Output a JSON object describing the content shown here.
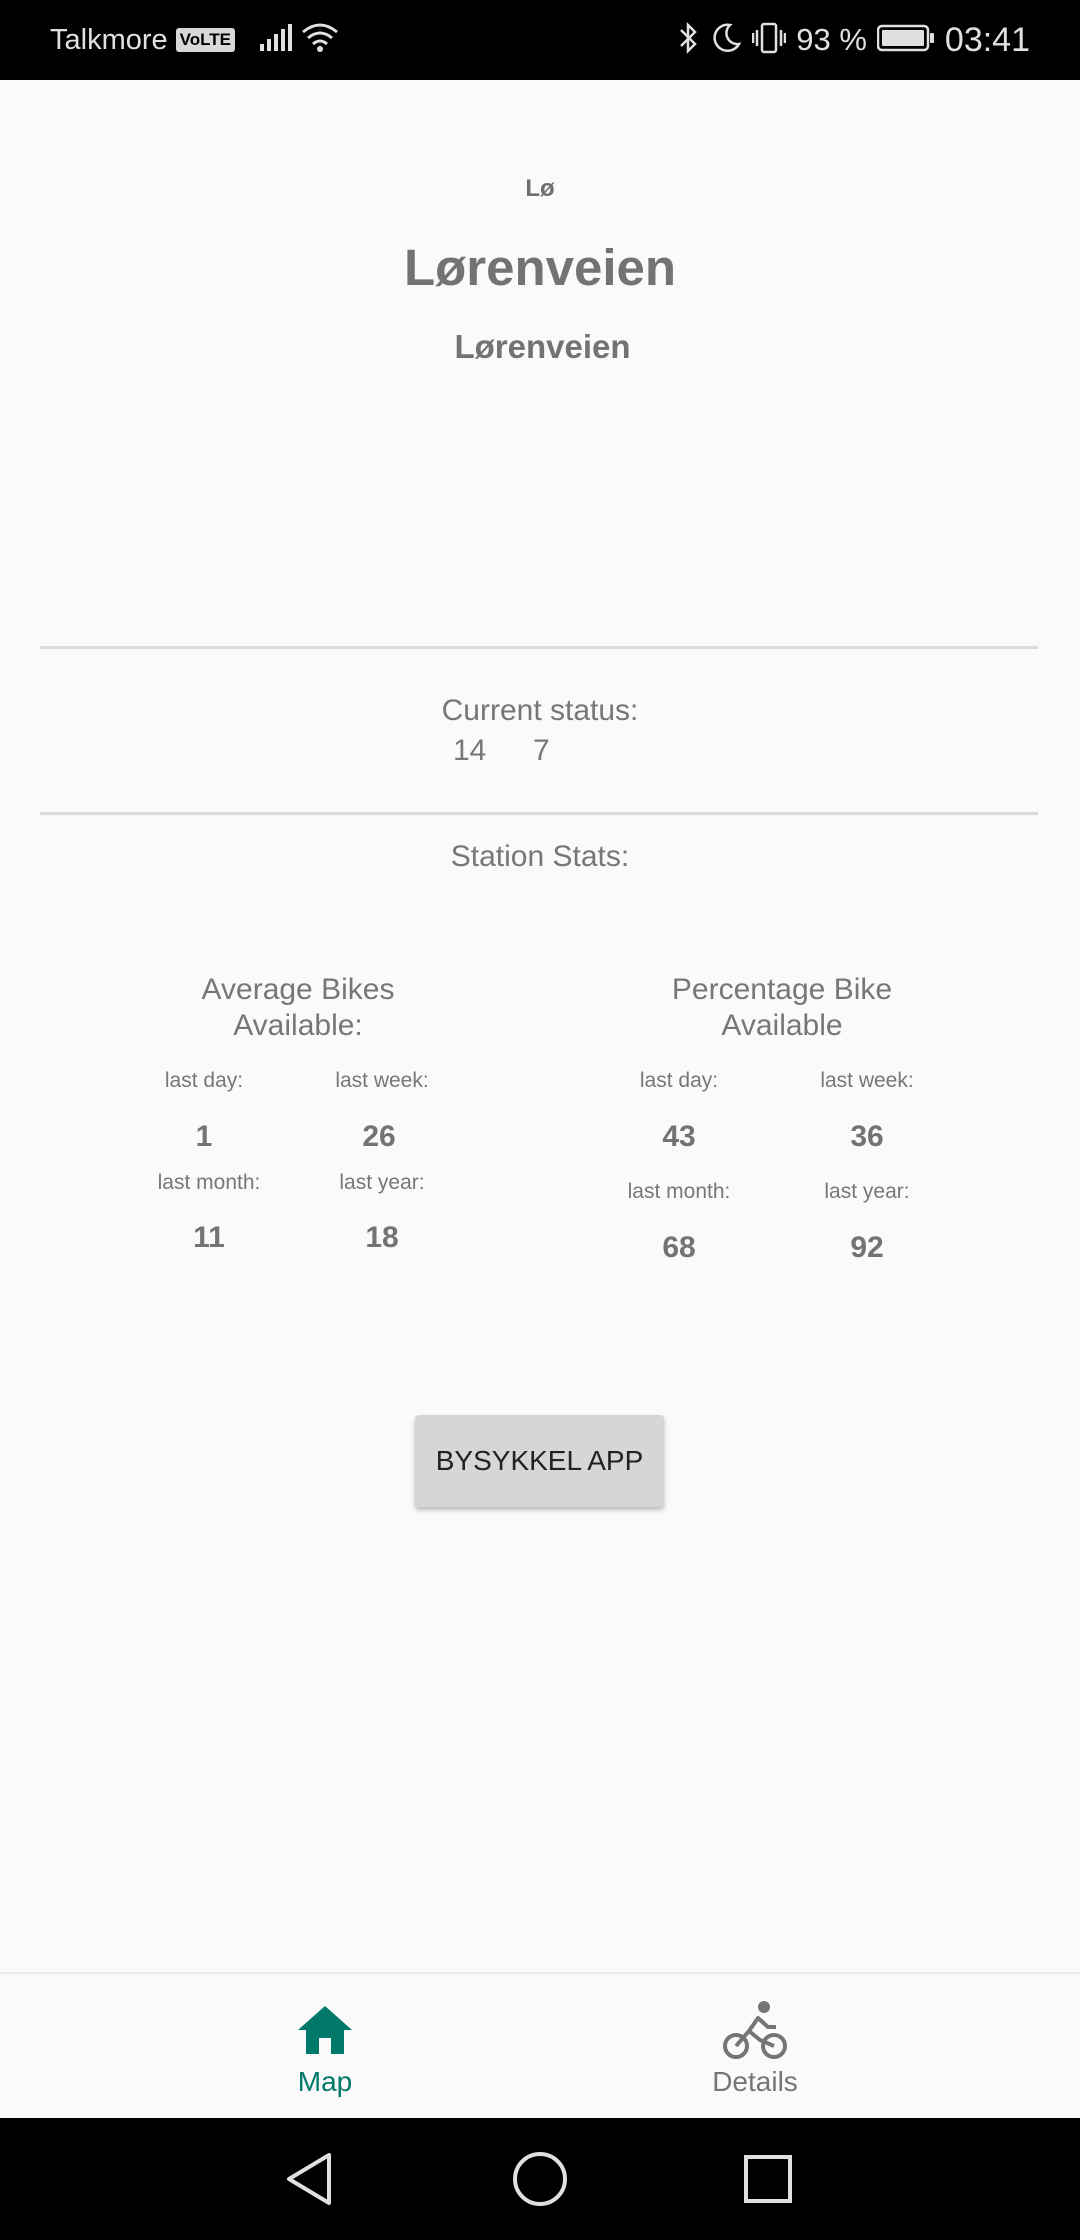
{
  "status_bar": {
    "carrier": "Talkmore",
    "volte": "VoLTE",
    "battery_percent": "93 %",
    "time": "03:41",
    "icons": [
      "signal-icon",
      "wifi-icon",
      "bluetooth-icon",
      "do-not-disturb-icon",
      "vibrate-icon",
      "battery-icon"
    ]
  },
  "station": {
    "short_name": "Lø",
    "title": "Lørenveien",
    "subtitle": "Lørenveien"
  },
  "current_status": {
    "label": "Current status:",
    "bikes": "14",
    "docks": "7"
  },
  "station_stats": {
    "label": "Station Stats:",
    "average": {
      "heading_line1": "Average Bikes",
      "heading_line2": "Available:",
      "last_day_label": "last day:",
      "last_day_value": "1",
      "last_week_label": "last week:",
      "last_week_value": "26",
      "last_month_label": "last month:",
      "last_month_value": "11",
      "last_year_label": "last year:",
      "last_year_value": "18"
    },
    "percentage": {
      "heading_line1": "Percentage Bike",
      "heading_line2": "Available",
      "last_day_label": "last day:",
      "last_day_value": "43",
      "last_week_label": "last week:",
      "last_week_value": "36",
      "last_month_label": "last month:",
      "last_month_value": "68",
      "last_year_label": "last year:",
      "last_year_value": "92"
    }
  },
  "app_button_label": "BYSYKKEL APP",
  "bottom_nav": {
    "map_label": "Map",
    "details_label": "Details",
    "active_color": "#00796b",
    "inactive_color": "#757575"
  }
}
